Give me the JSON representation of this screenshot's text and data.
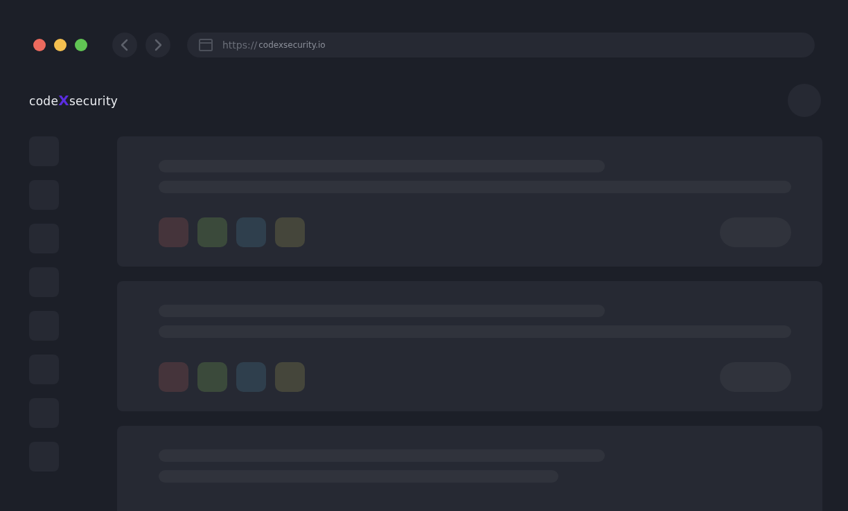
{
  "browser": {
    "url_scheme": "https://",
    "url_host": "codexsecurity.io"
  },
  "logo": "code**X**security",
  "cards": [
    {
      "kind": "full",
      "tags": [
        {
          "color": "#45343b"
        },
        {
          "color": "#3b4a3b"
        },
        {
          "color": "#2f3f4d"
        },
        {
          "color": "#45463b"
        }
      ]
    },
    {
      "kind": "full",
      "tags": [
        {
          "color": "#45343b"
        },
        {
          "color": "#3b4a3b"
        },
        {
          "color": "#2f3f4d"
        },
        {
          "color": "#45463b"
        }
      ]
    },
    {
      "kind": "partial"
    }
  ]
}
